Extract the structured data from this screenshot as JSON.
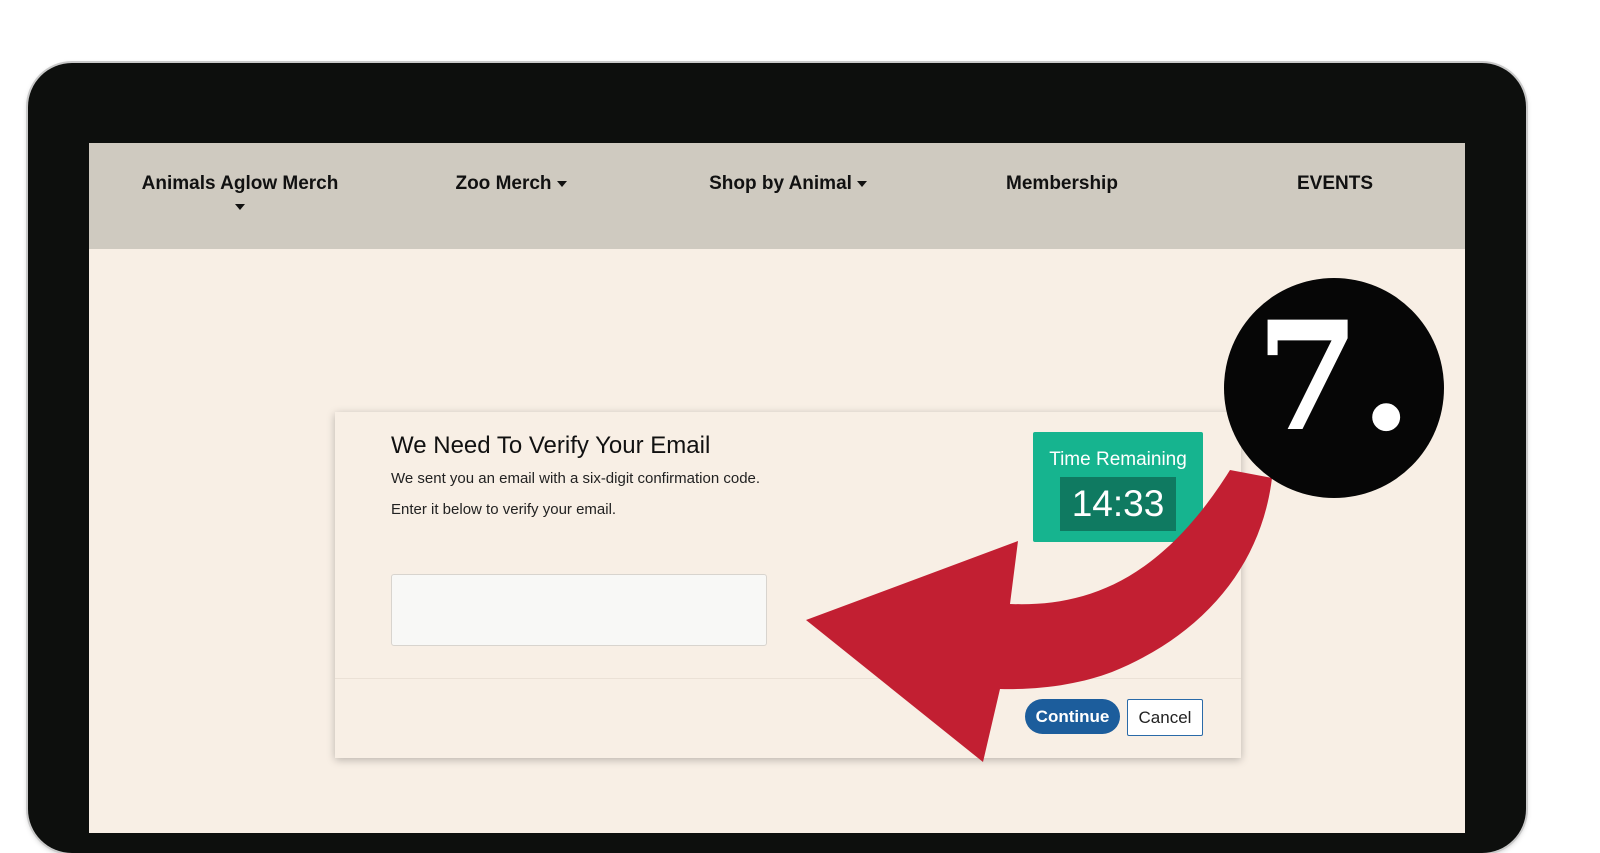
{
  "nav": {
    "items": [
      {
        "label": "Animals Aglow Merch",
        "has_dropdown": true
      },
      {
        "label": "Zoo Merch",
        "has_dropdown": true
      },
      {
        "label": "Shop by Animal",
        "has_dropdown": true
      },
      {
        "label": "Membership",
        "has_dropdown": false
      },
      {
        "label": "EVENTS",
        "has_dropdown": false
      }
    ]
  },
  "verify": {
    "title": "We Need To Verify Your Email",
    "line1": "We sent you an email with a six-digit confirmation code.",
    "line2": "Enter it below to verify your email.",
    "code_value": "",
    "code_placeholder": ""
  },
  "timer": {
    "label": "Time Remaining",
    "value": "14:33"
  },
  "buttons": {
    "continue": "Continue",
    "cancel": "Cancel"
  },
  "overlay": {
    "step_number": "7."
  },
  "colors": {
    "nav_bg": "#cfcac0",
    "page_bg": "#f8efe5",
    "timer_bg": "#16b48f",
    "timer_value_bg": "#0f7a61",
    "continue_bg": "#1c5d9c",
    "arrow": "#c21f32",
    "badge": "#060606"
  }
}
